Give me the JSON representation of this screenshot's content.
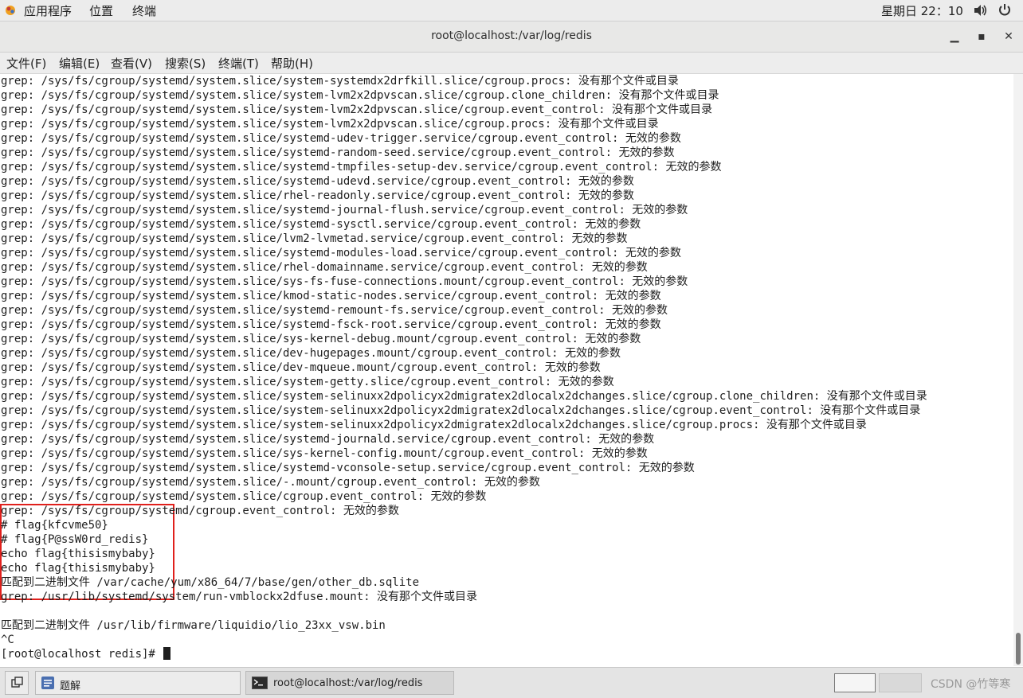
{
  "topbar": {
    "applications": "应用程序",
    "places": "位置",
    "terminal": "终端",
    "datetime": "星期日 22：10"
  },
  "window": {
    "title": "root@localhost:/var/log/redis",
    "minimize_glyph": "▁",
    "maximize_glyph": "▪",
    "close_glyph": "✕"
  },
  "menu": {
    "file": "文件(F)",
    "edit": "编辑(E)",
    "view": "查看(V)",
    "search": "搜索(S)",
    "terminal": "终端(T)",
    "help": "帮助(H)"
  },
  "terminal": {
    "lines": [
      "grep: /sys/fs/cgroup/systemd/system.slice/system-systemdx2drfkill.slice/cgroup.procs: 没有那个文件或目录",
      "grep: /sys/fs/cgroup/systemd/system.slice/system-lvm2x2dpvscan.slice/cgroup.clone_children: 没有那个文件或目录",
      "grep: /sys/fs/cgroup/systemd/system.slice/system-lvm2x2dpvscan.slice/cgroup.event_control: 没有那个文件或目录",
      "grep: /sys/fs/cgroup/systemd/system.slice/system-lvm2x2dpvscan.slice/cgroup.procs: 没有那个文件或目录",
      "grep: /sys/fs/cgroup/systemd/system.slice/systemd-udev-trigger.service/cgroup.event_control: 无效的参数",
      "grep: /sys/fs/cgroup/systemd/system.slice/systemd-random-seed.service/cgroup.event_control: 无效的参数",
      "grep: /sys/fs/cgroup/systemd/system.slice/systemd-tmpfiles-setup-dev.service/cgroup.event_control: 无效的参数",
      "grep: /sys/fs/cgroup/systemd/system.slice/systemd-udevd.service/cgroup.event_control: 无效的参数",
      "grep: /sys/fs/cgroup/systemd/system.slice/rhel-readonly.service/cgroup.event_control: 无效的参数",
      "grep: /sys/fs/cgroup/systemd/system.slice/systemd-journal-flush.service/cgroup.event_control: 无效的参数",
      "grep: /sys/fs/cgroup/systemd/system.slice/systemd-sysctl.service/cgroup.event_control: 无效的参数",
      "grep: /sys/fs/cgroup/systemd/system.slice/lvm2-lvmetad.service/cgroup.event_control: 无效的参数",
      "grep: /sys/fs/cgroup/systemd/system.slice/systemd-modules-load.service/cgroup.event_control: 无效的参数",
      "grep: /sys/fs/cgroup/systemd/system.slice/rhel-domainname.service/cgroup.event_control: 无效的参数",
      "grep: /sys/fs/cgroup/systemd/system.slice/sys-fs-fuse-connections.mount/cgroup.event_control: 无效的参数",
      "grep: /sys/fs/cgroup/systemd/system.slice/kmod-static-nodes.service/cgroup.event_control: 无效的参数",
      "grep: /sys/fs/cgroup/systemd/system.slice/systemd-remount-fs.service/cgroup.event_control: 无效的参数",
      "grep: /sys/fs/cgroup/systemd/system.slice/systemd-fsck-root.service/cgroup.event_control: 无效的参数",
      "grep: /sys/fs/cgroup/systemd/system.slice/sys-kernel-debug.mount/cgroup.event_control: 无效的参数",
      "grep: /sys/fs/cgroup/systemd/system.slice/dev-hugepages.mount/cgroup.event_control: 无效的参数",
      "grep: /sys/fs/cgroup/systemd/system.slice/dev-mqueue.mount/cgroup.event_control: 无效的参数",
      "grep: /sys/fs/cgroup/systemd/system.slice/system-getty.slice/cgroup.event_control: 无效的参数",
      "grep: /sys/fs/cgroup/systemd/system.slice/system-selinuxx2dpolicyx2dmigratex2dlocalx2dchanges.slice/cgroup.clone_children: 没有那个文件或目录",
      "grep: /sys/fs/cgroup/systemd/system.slice/system-selinuxx2dpolicyx2dmigratex2dlocalx2dchanges.slice/cgroup.event_control: 没有那个文件或目录",
      "grep: /sys/fs/cgroup/systemd/system.slice/system-selinuxx2dpolicyx2dmigratex2dlocalx2dchanges.slice/cgroup.procs: 没有那个文件或目录",
      "grep: /sys/fs/cgroup/systemd/system.slice/systemd-journald.service/cgroup.event_control: 无效的参数",
      "grep: /sys/fs/cgroup/systemd/system.slice/sys-kernel-config.mount/cgroup.event_control: 无效的参数",
      "grep: /sys/fs/cgroup/systemd/system.slice/systemd-vconsole-setup.service/cgroup.event_control: 无效的参数",
      "grep: /sys/fs/cgroup/systemd/system.slice/-.mount/cgroup.event_control: 无效的参数",
      "grep: /sys/fs/cgroup/systemd/system.slice/cgroup.event_control: 无效的参数",
      "grep: /sys/fs/cgroup/systemd/cgroup.event_control: 无效的参数",
      "# flag{kfcvme50}",
      "# flag{P@ssW0rd_redis}",
      "echo flag{thisismybaby}",
      "echo flag{thisismybaby}",
      "匹配到二进制文件 /var/cache/yum/x86_64/7/base/gen/other_db.sqlite",
      "grep: /usr/lib/systemd/system/run-vmblockx2dfuse.mount: 没有那个文件或目录",
      "",
      "匹配到二进制文件 /usr/lib/firmware/liquidio/lio_23xx_vsw.bin",
      "^C"
    ],
    "prompt": "[root@localhost redis]# "
  },
  "taskbar": {
    "task1": "题解",
    "task2": "root@localhost:/var/log/redis",
    "watermark": "CSDN @竹等寒"
  },
  "colors": {
    "highlight_box": "#e0201c",
    "topbar_bg": "#ececec",
    "taskbar_bg": "#e4e4e4"
  }
}
